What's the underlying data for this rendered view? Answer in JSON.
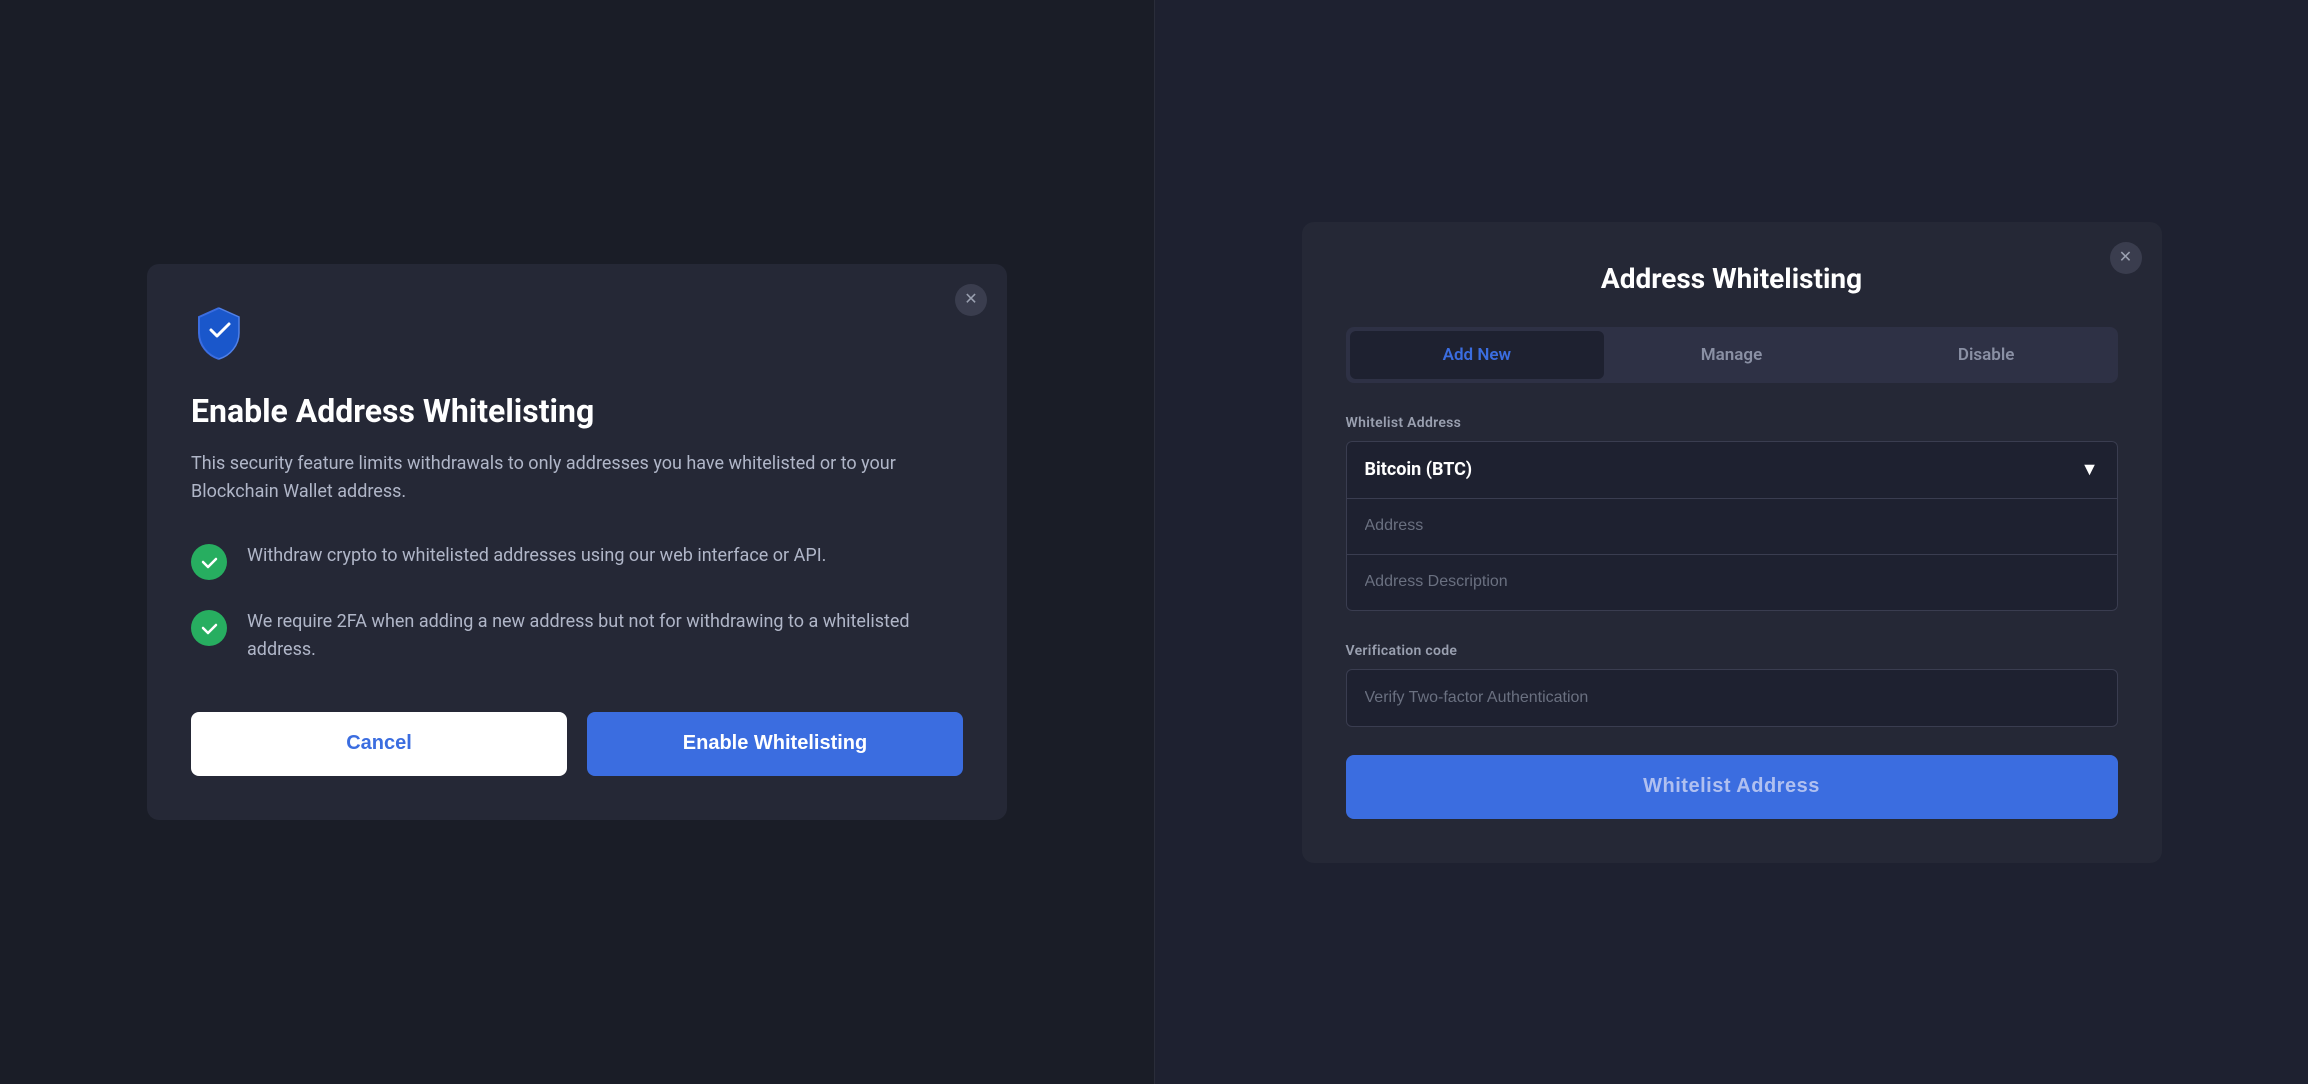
{
  "left_modal": {
    "title": "Enable Address Whitelisting",
    "description": "This security feature limits withdrawals to only addresses you have whitelisted or to your Blockchain Wallet address.",
    "features": [
      {
        "id": "feature-1",
        "text": "Withdraw crypto to whitelisted addresses using our web interface or API."
      },
      {
        "id": "feature-2",
        "text": "We require 2FA when adding a new address but not for withdrawing to a whitelisted address."
      }
    ],
    "cancel_label": "Cancel",
    "enable_label": "Enable Whitelisting"
  },
  "right_modal": {
    "title": "Address Whitelisting",
    "tabs": [
      {
        "id": "add-new",
        "label": "Add New",
        "active": true
      },
      {
        "id": "manage",
        "label": "Manage",
        "active": false
      },
      {
        "id": "disable",
        "label": "Disable",
        "active": false
      }
    ],
    "whitelist_address_label": "Whitelist Address",
    "currency_selected": "Bitcoin (BTC)",
    "address_placeholder": "Address",
    "address_description_placeholder": "Address Description",
    "verification_label": "Verification code",
    "verification_placeholder": "Verify Two-factor Authentication",
    "submit_label": "Whitelist Address"
  },
  "icons": {
    "close": "✕",
    "chevron_down": "▼"
  }
}
